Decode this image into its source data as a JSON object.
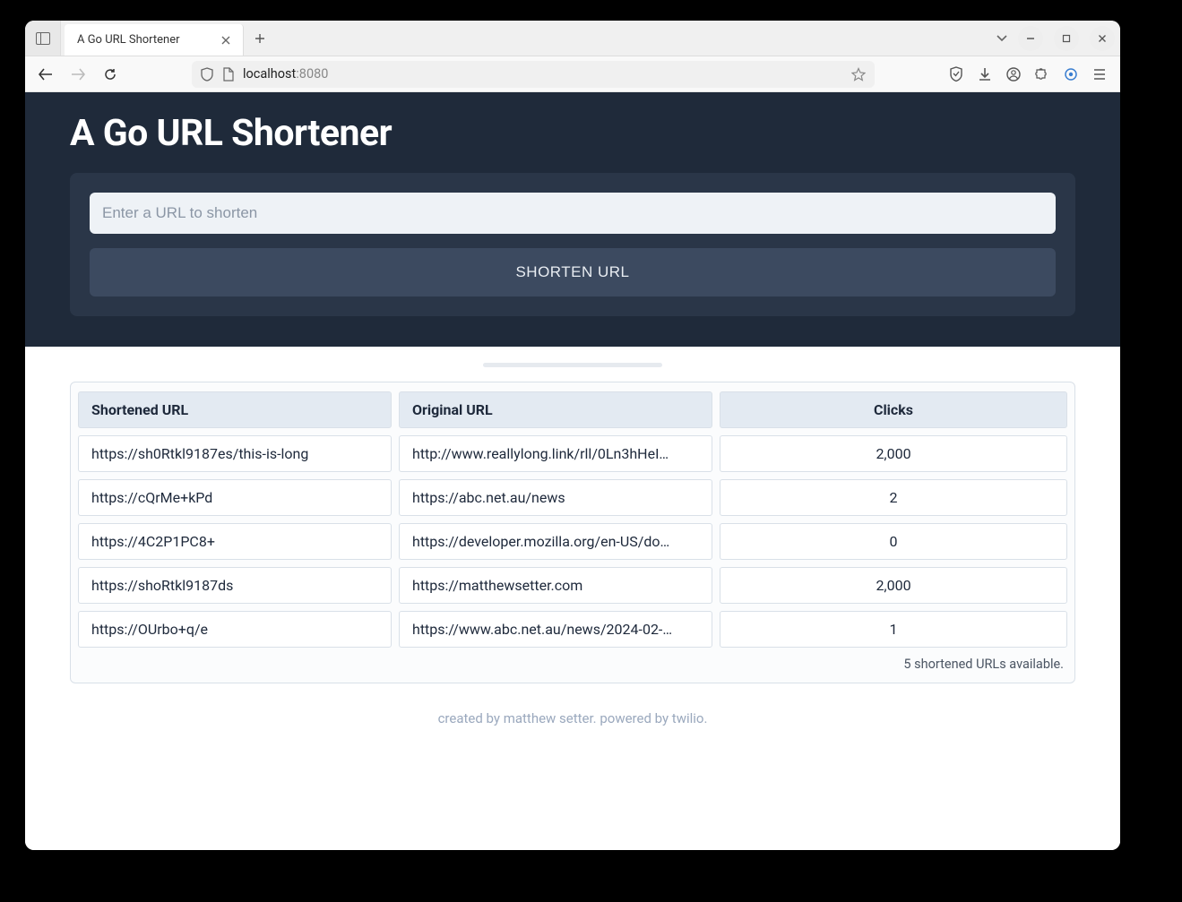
{
  "browser": {
    "tab_title": "A Go URL Shortener",
    "url_host": "localhost",
    "url_port": ":8080"
  },
  "hero": {
    "title": "A Go URL Shortener",
    "input_placeholder": "Enter a URL to shorten",
    "button_label": "SHORTEN URL"
  },
  "table": {
    "headers": {
      "shortened": "Shortened URL",
      "original": "Original URL",
      "clicks": "Clicks"
    },
    "rows": [
      {
        "shortened": "https://sh0Rtkl9187es/this-is-long",
        "original": "http://www.reallylong.link/rll/0Ln3hHeI…",
        "clicks": "2,000"
      },
      {
        "shortened": "https://cQrMe+kPd",
        "original": "https://abc.net.au/news",
        "clicks": "2"
      },
      {
        "shortened": "https://4C2P1PC8+",
        "original": "https://developer.mozilla.org/en-US/do…",
        "clicks": "0"
      },
      {
        "shortened": "https://shoRtkl9187ds",
        "original": "https://matthewsetter.com",
        "clicks": "2,000"
      },
      {
        "shortened": "https://OUrbo+q/e",
        "original": "https://www.abc.net.au/news/2024-02-…",
        "clicks": "1"
      }
    ],
    "summary": "5 shortened URLs available."
  },
  "footer": {
    "text": "created by matthew setter. powered by twilio."
  }
}
